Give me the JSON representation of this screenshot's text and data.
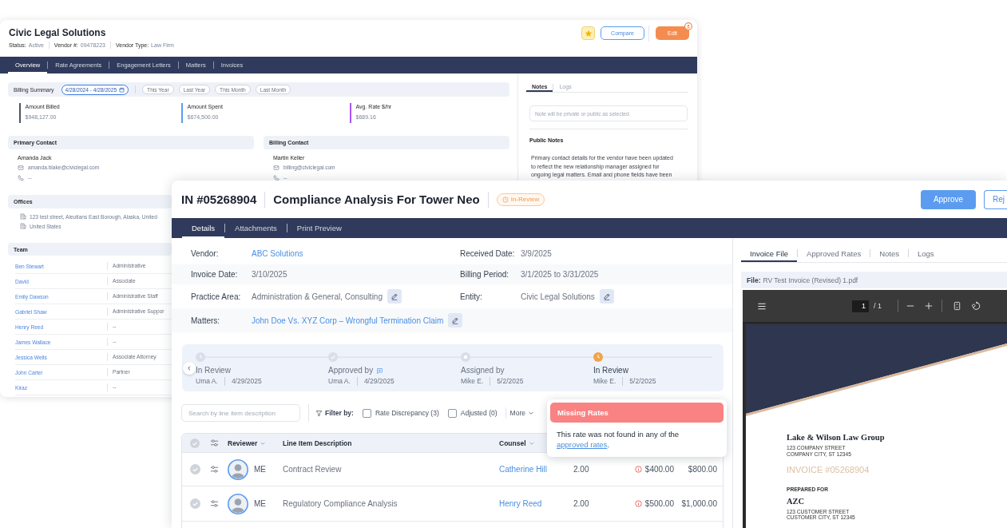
{
  "vendor_window": {
    "title": "Civic Legal Solutions",
    "meta": [
      {
        "label": "Status:",
        "value": "Active"
      },
      {
        "label": "Vendor #:",
        "value": "09478223"
      },
      {
        "label": "Vendor Type:",
        "value": "Law Firm"
      }
    ],
    "buttons": [
      {
        "label": "Compare",
        "kind": "outline"
      },
      {
        "label": "Edit",
        "kind": "primary"
      }
    ],
    "tabs": [
      {
        "label": "Overview",
        "selected": true
      },
      {
        "label": "Rate Agreements",
        "selected": false
      },
      {
        "label": "Engagement Letters",
        "selected": false
      },
      {
        "label": "Matters",
        "selected": false
      },
      {
        "label": "Invoices",
        "selected": false
      }
    ],
    "billing_summary": {
      "title": "Billing Summary",
      "date_range": "4/28/2024 - 4/28/2025",
      "presets": [
        {
          "label": "This Year",
          "selected": false
        },
        {
          "label": "Last Year",
          "selected": false
        },
        {
          "label": "This Month",
          "selected": false
        },
        {
          "label": "Last Month",
          "selected": false
        }
      ],
      "metrics": [
        {
          "label": "Amount Billed",
          "value": "$948,127.00",
          "color": "#4b5563"
        },
        {
          "label": "Amount Spent",
          "value": "$674,500.00",
          "color": "#5b9cf0"
        },
        {
          "label": "Avg. Rate $/hr",
          "value": "$689.16",
          "color": "#a855f7"
        }
      ]
    },
    "contacts": [
      {
        "title": "Primary Contact",
        "name": "Amanda Jack",
        "email": "amanda.blake@civiclegal.com",
        "phone": "--"
      },
      {
        "title": "Billing Contact",
        "name": "Martin Keller",
        "email": "billing@civiclegal.com",
        "phone": "--"
      }
    ],
    "offices": {
      "title": "Offices",
      "lines": [
        "123 test street, Aleutians East Borough, Alaska, United",
        "United States"
      ]
    },
    "team": {
      "title": "Team",
      "rows": [
        {
          "name": "Ben Stewart",
          "role": "Administrative"
        },
        {
          "name": "David",
          "role": "Associate"
        },
        {
          "name": "Emily Dawson",
          "role": "Administrative Staff"
        },
        {
          "name": "Gabriel Shaw",
          "role": "Administrative Suppor"
        },
        {
          "name": "Henry Reed",
          "role": "--"
        },
        {
          "name": "James Wallace",
          "role": "--"
        },
        {
          "name": "Jessica Wells",
          "role": "Associate Attorney"
        },
        {
          "name": "John Carter",
          "role": "Partner"
        },
        {
          "name": "Kiraz",
          "role": "--"
        }
      ]
    },
    "notes": {
      "tabs": [
        {
          "label": "Notes",
          "selected": true
        },
        {
          "label": "Logs",
          "selected": false
        }
      ],
      "placeholder": "Note will be private or public as selected.",
      "heading": "Public Notes",
      "text": "Primary contact details for the vendor have been updated to reflect the new relationship manager assigned for ongoing legal matters. Email and phone fields have been"
    }
  },
  "invoice_window": {
    "number": "IN #05268904",
    "title": "Compliance Analysis For Tower Neo",
    "status": "In-Review",
    "buttons": [
      {
        "label": "Approve",
        "kind": "primary"
      },
      {
        "label": "Rej",
        "kind": "outline"
      }
    ],
    "tabs": [
      {
        "label": "Details",
        "selected": true
      },
      {
        "label": "Attachments",
        "selected": false
      },
      {
        "label": "Print Preview",
        "selected": false
      }
    ],
    "details": [
      {
        "fields": [
          {
            "label": "Vendor:",
            "value": "ABC Solutions",
            "kind": "link",
            "editable": false
          },
          {
            "label": "Received Date:",
            "value": "3/9/2025",
            "kind": "text",
            "editable": false
          }
        ]
      },
      {
        "fields": [
          {
            "label": "Invoice Date:",
            "value": "3/10/2025",
            "kind": "text",
            "editable": false
          },
          {
            "label": "Billing Period:",
            "value": "3/1/2025 to 3/31/2025",
            "kind": "text",
            "editable": false
          }
        ]
      },
      {
        "fields": [
          {
            "label": "Practice Area:",
            "value": "Administration & General, Consulting",
            "kind": "text",
            "editable": true
          },
          {
            "label": "Entity:",
            "value": "Civic Legal Solutions",
            "kind": "text",
            "editable": true
          }
        ]
      },
      {
        "fields": [
          {
            "label": "Matters:",
            "value": "John Doe Vs. XYZ Corp – Wrongful Termination Claim",
            "kind": "link",
            "editable": true
          }
        ]
      }
    ],
    "timeline": [
      {
        "title": "In Review",
        "person": "Uma A.",
        "date": "4/29/2025",
        "kind": "clock",
        "current": false,
        "comment": false
      },
      {
        "title": "Approved by",
        "person": "Uma A.",
        "date": "4/29/2025",
        "kind": "check",
        "current": false,
        "comment": true
      },
      {
        "title": "Assigned by",
        "person": "Mike E.",
        "date": "5/2/2025",
        "kind": "dot",
        "current": false,
        "comment": false
      },
      {
        "title": "In Review",
        "person": "Mike E.",
        "date": "5/2/2025",
        "kind": "clock",
        "current": true,
        "comment": false
      }
    ],
    "filters": {
      "placeholder": "Search by line item description",
      "label": "Filter by:",
      "options": [
        {
          "label": "Rate Discrepancy (3)",
          "checked": false
        },
        {
          "label": "Adjusted (0)",
          "checked": false
        }
      ],
      "more": "More"
    },
    "popover": {
      "title": "Missing Rates",
      "text": "This rate was not found in any of the",
      "link": "approved rates",
      "end": "."
    },
    "table": {
      "columns": [
        {
          "label": "Reviewer",
          "sortable": true
        },
        {
          "label": "Line Item Description",
          "sortable": false
        },
        {
          "label": "Counsel",
          "sortable": true
        }
      ],
      "rows": [
        {
          "reviewer": "ME",
          "description": "Contract Review",
          "counsel": "Catherine Hill",
          "hours": "2.00",
          "rate": "$400.00",
          "rate_warning": true,
          "amount": "$800.00"
        },
        {
          "reviewer": "ME",
          "description": "Regulatory Compliance Analysis",
          "counsel": "Henry Reed",
          "hours": "2.00",
          "rate": "$500.00",
          "rate_warning": true,
          "amount": "$1,000.00"
        }
      ]
    },
    "file_panel": {
      "tabs": [
        {
          "label": "Invoice File",
          "selected": true
        },
        {
          "label": "Approved Rates",
          "selected": false
        },
        {
          "label": "Notes",
          "selected": false
        },
        {
          "label": "Logs",
          "selected": false
        }
      ],
      "file_label": "File:",
      "file_name": "RV Test Invoice (Revised) 1.pdf",
      "page": "1",
      "page_total": "/ 1",
      "document": {
        "firm": "Lake & Wilson Law Group",
        "firm_address": [
          "123 COMPANY STREET",
          "COMPANY CITY, ST 12345"
        ],
        "invoice": "INVOICE #05268904",
        "prepared_for": "PREPARED FOR",
        "client": "AZC",
        "client_address": [
          "123 CUSTOMER STREET",
          "CUSTOMER CITY, ST 12345"
        ]
      }
    }
  }
}
